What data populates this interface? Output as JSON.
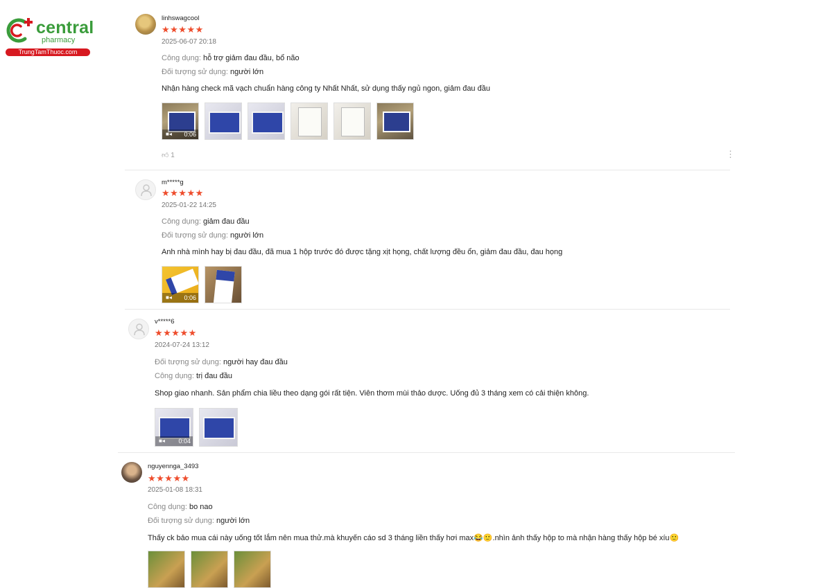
{
  "logo": {
    "name": "central",
    "subtitle": "pharmacy",
    "site": "TrungTamThuoc.com"
  },
  "reviews": [
    {
      "user": "linhswagcool",
      "stars": "★★★★★",
      "date": "2025-06-07 20:18",
      "attr1_key": "Công dụng:",
      "attr1_val": "hỗ trợ giảm đau đầu, bổ não",
      "attr2_key": "Đối tượng sử dụng:",
      "attr2_val": "người lớn",
      "comment": "Nhận hàng check mã vạch chuẩn hàng công ty Nhất Nhất, sử dụng thấy ngủ ngon, giảm đau đầu",
      "video_duration": "0:06",
      "likes": "1"
    },
    {
      "user": "m*****g",
      "stars": "★★★★★",
      "date": "2025-01-22 14:25",
      "attr1_key": "Công dụng:",
      "attr1_val": "giảm đau đầu",
      "attr2_key": "Đối tượng sử dụng:",
      "attr2_val": "người lớn",
      "comment": "Anh nhà mình hay bị đau đầu, đã mua 1 hộp trước đó được tặng xịt họng, chất lượng đều ổn, giảm đau đầu, đau họng",
      "video_duration": "0:06"
    },
    {
      "user": "v*****6",
      "stars": "★★★★★",
      "date": "2024-07-24 13:12",
      "attr1_key": "Đối tượng sử dụng:",
      "attr1_val": "người hay đau đầu",
      "attr2_key": "Công dụng:",
      "attr2_val": "trị đau đầu",
      "comment": "Shop giao nhanh. Sản phẩm chia liều theo dạng gói rất tiện. Viên thơm mùi thảo dược. Uống đủ 3 tháng xem có cải thiện không.",
      "video_duration": "0:04"
    },
    {
      "user": "nguyennga_3493",
      "stars": "★★★★★",
      "date": "2025-01-08 18:31",
      "attr1_key": "Công dụng:",
      "attr1_val": "bo nao",
      "attr2_key": "Đối tượng sử dụng:",
      "attr2_val": "người lớn",
      "comment": "Thấy ck bảo mua cái này uống tốt lắm nên mua thử.mà khuyến cáo sd 3 tháng liền thấy hơi max😂🙂.nhìn ảnh thấy hộp to mà nhận hàng thấy hộp bé xíu🙂"
    }
  ],
  "icons": {
    "video": "video-camera-icon",
    "like": "thumbs-up-icon",
    "more": "more-vertical-icon",
    "avatar": "default-user-icon"
  },
  "colors": {
    "brand_green": "#3a9c3b",
    "brand_red": "#d71920",
    "star": "#ee4d2d"
  }
}
